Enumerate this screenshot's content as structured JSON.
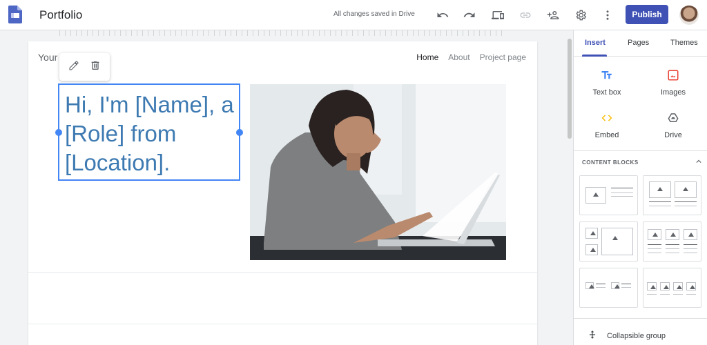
{
  "app": {
    "title": "Portfolio",
    "save_status": "All changes saved in Drive",
    "publish_label": "Publish"
  },
  "toolbar_icons": [
    "undo-icon",
    "redo-icon",
    "preview-icon",
    "link-icon",
    "add-person-icon",
    "settings-icon",
    "more-vert-icon"
  ],
  "site": {
    "title": "Your",
    "nav": [
      "Home",
      "About",
      "Project page"
    ],
    "hero_lines": [
      "Hi, I'm [Name], a",
      "[Role] from",
      "[Location]."
    ]
  },
  "panel": {
    "tabs": [
      "Insert",
      "Pages",
      "Themes"
    ],
    "insert_items": [
      "Text box",
      "Images",
      "Embed",
      "Drive"
    ],
    "content_blocks_header": "CONTENT BLOCKS",
    "collapsible_label": "Collapsible group"
  },
  "colors": {
    "accent": "#3f51b5",
    "selection": "#4285f4",
    "hero_text": "#3e7ab2",
    "images_icon": "#ea4335",
    "embed_icon": "#fbbc04"
  }
}
